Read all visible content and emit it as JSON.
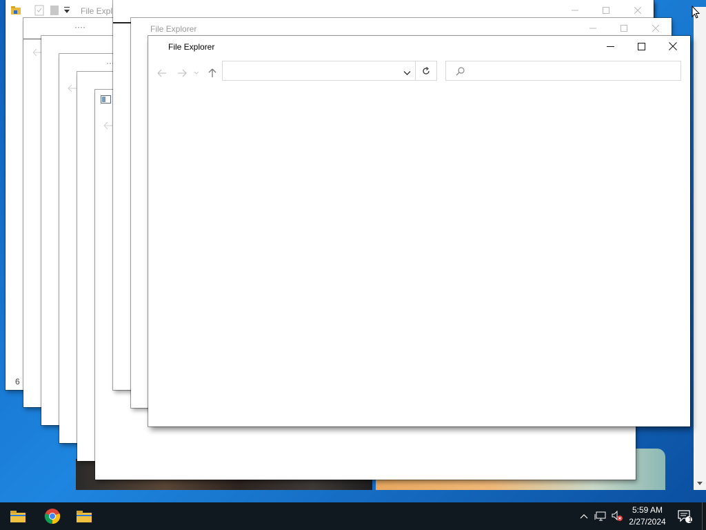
{
  "windows": {
    "back_title_1": "File Expl",
    "back_title_2": "File Explorer",
    "ghost_dots_1": "····",
    "ghost_dots_2": "···",
    "status_fragment": "6"
  },
  "main_window": {
    "title": "File Explorer",
    "address_value": "",
    "search_placeholder": ""
  },
  "icons": {
    "back": "back-arrow-icon",
    "forward": "forward-arrow-icon",
    "recent": "recent-locations-icon",
    "up": "up-arrow-icon",
    "dropdown": "chevron-down-icon",
    "refresh": "refresh-icon",
    "search": "search-icon",
    "minimize": "minimize-icon",
    "maximize": "maximize-icon",
    "close": "close-icon"
  },
  "taskbar": {
    "apps": [
      "file-explorer",
      "chrome",
      "file-explorer"
    ],
    "time": "5:59 AM",
    "date": "2/27/2024",
    "notification_count": "1"
  },
  "colors": {
    "taskbar": "#101820",
    "desktop": "#1e86e0"
  }
}
